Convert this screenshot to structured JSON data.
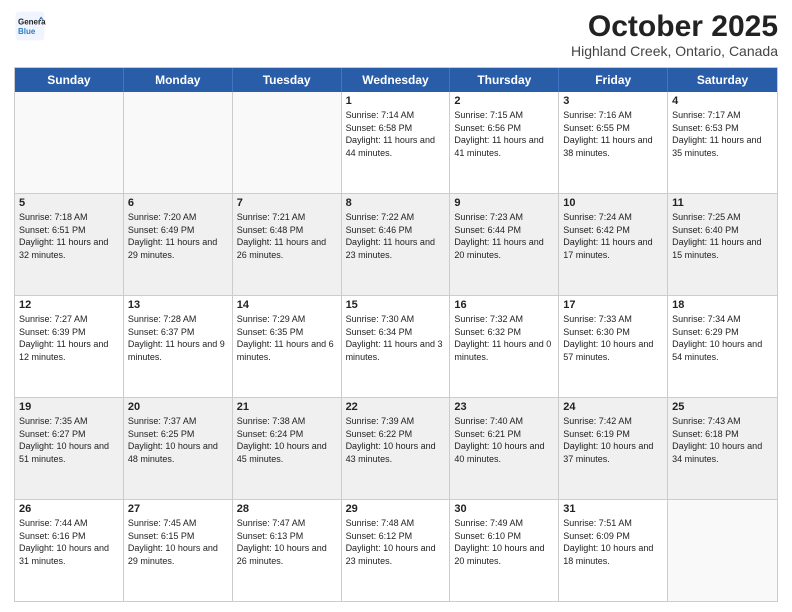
{
  "header": {
    "logo": {
      "line1": "General",
      "line2": "Blue"
    },
    "title": "October 2025",
    "location": "Highland Creek, Ontario, Canada"
  },
  "day_headers": [
    "Sunday",
    "Monday",
    "Tuesday",
    "Wednesday",
    "Thursday",
    "Friday",
    "Saturday"
  ],
  "weeks": [
    [
      {
        "num": "",
        "info": "",
        "empty": true
      },
      {
        "num": "",
        "info": "",
        "empty": true
      },
      {
        "num": "",
        "info": "",
        "empty": true
      },
      {
        "num": "1",
        "info": "Sunrise: 7:14 AM\nSunset: 6:58 PM\nDaylight: 11 hours and 44 minutes."
      },
      {
        "num": "2",
        "info": "Sunrise: 7:15 AM\nSunset: 6:56 PM\nDaylight: 11 hours and 41 minutes."
      },
      {
        "num": "3",
        "info": "Sunrise: 7:16 AM\nSunset: 6:55 PM\nDaylight: 11 hours and 38 minutes."
      },
      {
        "num": "4",
        "info": "Sunrise: 7:17 AM\nSunset: 6:53 PM\nDaylight: 11 hours and 35 minutes."
      }
    ],
    [
      {
        "num": "5",
        "info": "Sunrise: 7:18 AM\nSunset: 6:51 PM\nDaylight: 11 hours and 32 minutes."
      },
      {
        "num": "6",
        "info": "Sunrise: 7:20 AM\nSunset: 6:49 PM\nDaylight: 11 hours and 29 minutes."
      },
      {
        "num": "7",
        "info": "Sunrise: 7:21 AM\nSunset: 6:48 PM\nDaylight: 11 hours and 26 minutes."
      },
      {
        "num": "8",
        "info": "Sunrise: 7:22 AM\nSunset: 6:46 PM\nDaylight: 11 hours and 23 minutes."
      },
      {
        "num": "9",
        "info": "Sunrise: 7:23 AM\nSunset: 6:44 PM\nDaylight: 11 hours and 20 minutes."
      },
      {
        "num": "10",
        "info": "Sunrise: 7:24 AM\nSunset: 6:42 PM\nDaylight: 11 hours and 17 minutes."
      },
      {
        "num": "11",
        "info": "Sunrise: 7:25 AM\nSunset: 6:40 PM\nDaylight: 11 hours and 15 minutes."
      }
    ],
    [
      {
        "num": "12",
        "info": "Sunrise: 7:27 AM\nSunset: 6:39 PM\nDaylight: 11 hours and 12 minutes."
      },
      {
        "num": "13",
        "info": "Sunrise: 7:28 AM\nSunset: 6:37 PM\nDaylight: 11 hours and 9 minutes."
      },
      {
        "num": "14",
        "info": "Sunrise: 7:29 AM\nSunset: 6:35 PM\nDaylight: 11 hours and 6 minutes."
      },
      {
        "num": "15",
        "info": "Sunrise: 7:30 AM\nSunset: 6:34 PM\nDaylight: 11 hours and 3 minutes."
      },
      {
        "num": "16",
        "info": "Sunrise: 7:32 AM\nSunset: 6:32 PM\nDaylight: 11 hours and 0 minutes."
      },
      {
        "num": "17",
        "info": "Sunrise: 7:33 AM\nSunset: 6:30 PM\nDaylight: 10 hours and 57 minutes."
      },
      {
        "num": "18",
        "info": "Sunrise: 7:34 AM\nSunset: 6:29 PM\nDaylight: 10 hours and 54 minutes."
      }
    ],
    [
      {
        "num": "19",
        "info": "Sunrise: 7:35 AM\nSunset: 6:27 PM\nDaylight: 10 hours and 51 minutes."
      },
      {
        "num": "20",
        "info": "Sunrise: 7:37 AM\nSunset: 6:25 PM\nDaylight: 10 hours and 48 minutes."
      },
      {
        "num": "21",
        "info": "Sunrise: 7:38 AM\nSunset: 6:24 PM\nDaylight: 10 hours and 45 minutes."
      },
      {
        "num": "22",
        "info": "Sunrise: 7:39 AM\nSunset: 6:22 PM\nDaylight: 10 hours and 43 minutes."
      },
      {
        "num": "23",
        "info": "Sunrise: 7:40 AM\nSunset: 6:21 PM\nDaylight: 10 hours and 40 minutes."
      },
      {
        "num": "24",
        "info": "Sunrise: 7:42 AM\nSunset: 6:19 PM\nDaylight: 10 hours and 37 minutes."
      },
      {
        "num": "25",
        "info": "Sunrise: 7:43 AM\nSunset: 6:18 PM\nDaylight: 10 hours and 34 minutes."
      }
    ],
    [
      {
        "num": "26",
        "info": "Sunrise: 7:44 AM\nSunset: 6:16 PM\nDaylight: 10 hours and 31 minutes."
      },
      {
        "num": "27",
        "info": "Sunrise: 7:45 AM\nSunset: 6:15 PM\nDaylight: 10 hours and 29 minutes."
      },
      {
        "num": "28",
        "info": "Sunrise: 7:47 AM\nSunset: 6:13 PM\nDaylight: 10 hours and 26 minutes."
      },
      {
        "num": "29",
        "info": "Sunrise: 7:48 AM\nSunset: 6:12 PM\nDaylight: 10 hours and 23 minutes."
      },
      {
        "num": "30",
        "info": "Sunrise: 7:49 AM\nSunset: 6:10 PM\nDaylight: 10 hours and 20 minutes."
      },
      {
        "num": "31",
        "info": "Sunrise: 7:51 AM\nSunset: 6:09 PM\nDaylight: 10 hours and 18 minutes."
      },
      {
        "num": "",
        "info": "",
        "empty": true
      }
    ]
  ]
}
